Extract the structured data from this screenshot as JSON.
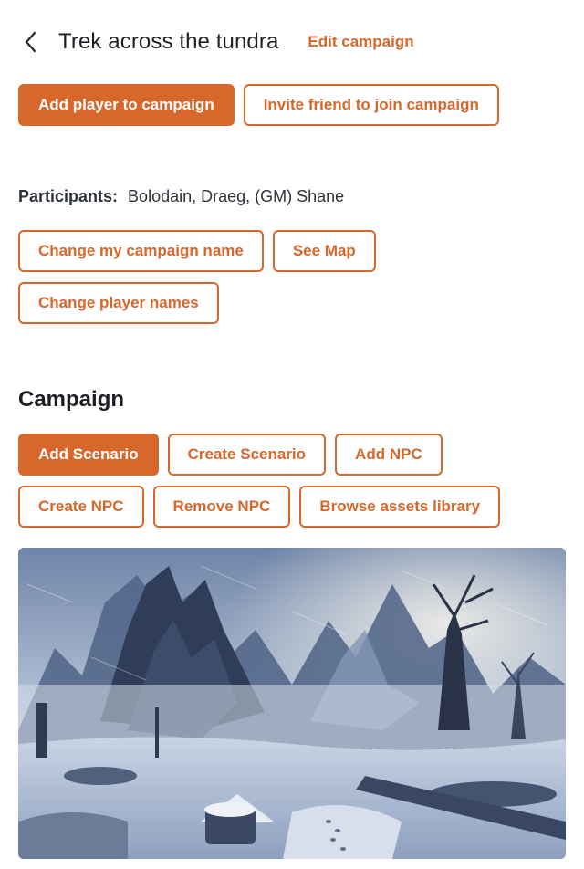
{
  "header": {
    "title": "Trek across the tundra",
    "edit_label": "Edit campaign"
  },
  "top_actions": {
    "add_player": "Add player to campaign",
    "invite_friend": "Invite friend to join campaign"
  },
  "participants": {
    "label": "Participants:",
    "names": "Bolodain, Draeg, (GM) Shane"
  },
  "participant_actions": {
    "change_campaign_name": "Change my campaign name",
    "see_map": "See Map",
    "change_player_names": "Change player names"
  },
  "campaign": {
    "title": "Campaign",
    "add_scenario": "Add Scenario",
    "create_scenario": "Create Scenario",
    "add_npc": "Add NPC",
    "create_npc": "Create NPC",
    "remove_npc": "Remove NPC",
    "browse_assets": "Browse assets library"
  },
  "colors": {
    "accent": "#d8672b"
  },
  "icons": {
    "back": "chevron-left-icon"
  }
}
